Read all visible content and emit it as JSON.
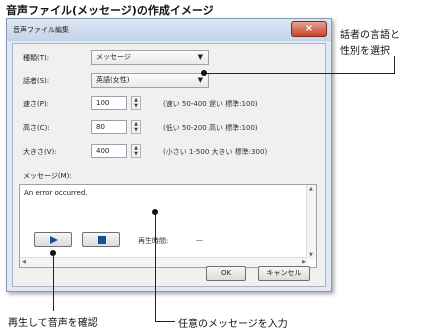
{
  "page_title": "音声ファイル(メッセージ)の作成イメージ",
  "dialog": {
    "title": "音声ファイル編集",
    "close_glyph": "×",
    "type_label": "種類(T):",
    "type_value": "メッセージ",
    "speaker_label": "話者(S):",
    "speaker_value": "英語(女性)",
    "speed_label": "速さ(P):",
    "speed_value": "100",
    "speed_hint": "(速い 50-400 遅い 標準:100)",
    "pitch_label": "高さ(C):",
    "pitch_value": "80",
    "pitch_hint": "(低い 50-200 高い 標準:100)",
    "volume_label": "大きさ(V):",
    "volume_value": "400",
    "volume_hint": "(小さい 1-500 大きい 標準:300)",
    "message_label": "メッセージ(M):",
    "message_text": "An error occurred.",
    "playtime_label": "再生時間:",
    "playtime_value": "—",
    "ok_label": "OK",
    "cancel_label": "キャンセル"
  },
  "callouts": {
    "speaker_note_line1": "話者の言語と",
    "speaker_note_line2": "性別を選択",
    "play_note": "再生して音声を確認",
    "message_note": "任意のメッセージを入力"
  }
}
